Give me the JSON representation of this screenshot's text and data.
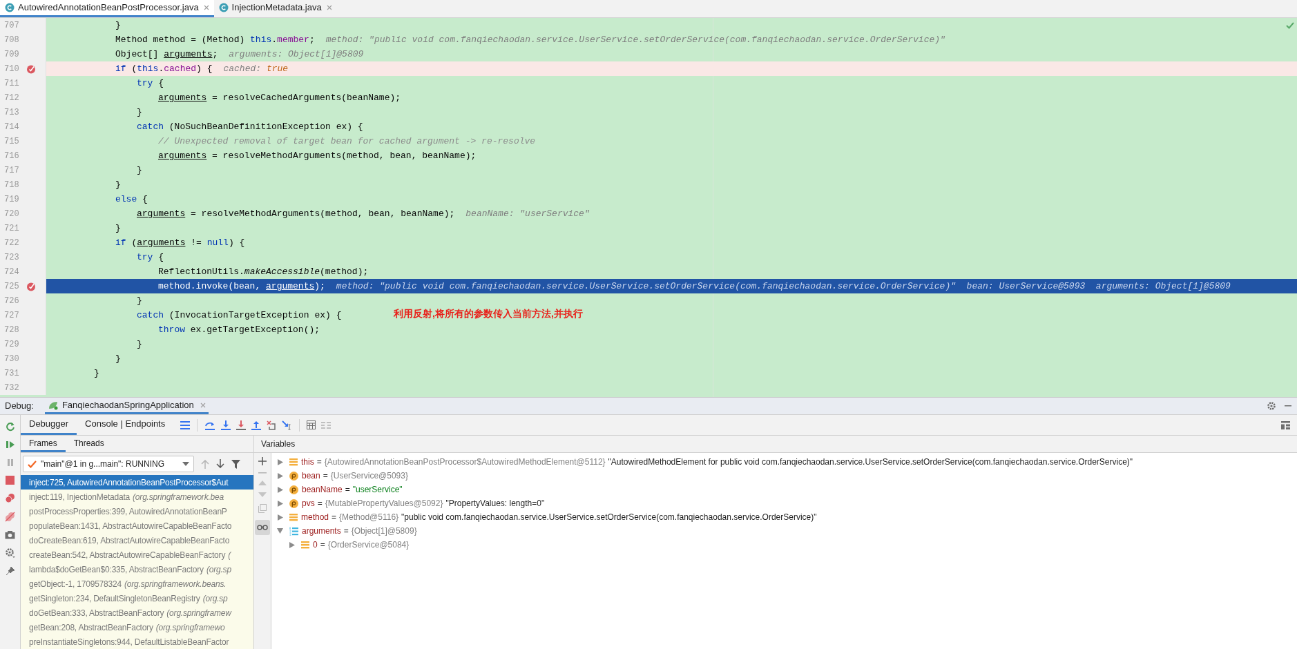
{
  "editor_tabs": [
    {
      "label": "AutowiredAnnotationBeanPostProcessor.java",
      "selected": true
    },
    {
      "label": "InjectionMetadata.java",
      "selected": false
    }
  ],
  "code_lines": [
    {
      "number": "707",
      "kind": "indent2",
      "breakpoint": false,
      "current": false,
      "segments": [
        {
          "kind": "plain",
          "text": "}"
        }
      ]
    },
    {
      "number": "708",
      "kind": "indent2",
      "breakpoint": false,
      "current": false,
      "segments": [
        {
          "kind": "plain",
          "text": "Method method = (Method) "
        },
        {
          "kind": "keyword",
          "text": "this"
        },
        {
          "kind": "plain",
          "text": "."
        },
        {
          "kind": "field",
          "text": "member"
        },
        {
          "kind": "plain",
          "text": ";"
        }
      ],
      "hints": [
        {
          "kind": "hint",
          "text": "method: \"public void com.fanqiechaodan.service.UserService.setOrderService(com.fanqiechaodan.service.OrderService)\""
        }
      ]
    },
    {
      "number": "709",
      "kind": "indent2",
      "breakpoint": false,
      "current": false,
      "segments": [
        {
          "kind": "plain",
          "text": "Object[] "
        },
        {
          "kind": "var",
          "text": "arguments"
        },
        {
          "kind": "plain",
          "text": ";"
        }
      ],
      "hints": [
        {
          "kind": "hint",
          "text": "arguments: Object[1]@5809"
        }
      ]
    },
    {
      "number": "710",
      "kind": "indent2",
      "breakpoint": true,
      "current": false,
      "segments": [
        {
          "kind": "keyword",
          "text": "if"
        },
        {
          "kind": "plain",
          "text": " ("
        },
        {
          "kind": "keyword",
          "text": "this"
        },
        {
          "kind": "plain",
          "text": "."
        },
        {
          "kind": "field",
          "text": "cached"
        },
        {
          "kind": "plain",
          "text": ") {"
        }
      ],
      "hints": [
        {
          "kind": "hint",
          "text": "cached: "
        },
        {
          "kind": "hint_value",
          "text": "true"
        }
      ]
    },
    {
      "number": "711",
      "kind": "indent3",
      "breakpoint": false,
      "current": false,
      "segments": [
        {
          "kind": "keyword",
          "text": "try"
        },
        {
          "kind": "plain",
          "text": " {"
        }
      ]
    },
    {
      "number": "712",
      "kind": "indent4",
      "breakpoint": false,
      "current": false,
      "segments": [
        {
          "kind": "var",
          "text": "arguments"
        },
        {
          "kind": "plain",
          "text": " = resolveCachedArguments(beanName);"
        }
      ]
    },
    {
      "number": "713",
      "kind": "indent3",
      "breakpoint": false,
      "current": false,
      "segments": [
        {
          "kind": "plain",
          "text": "}"
        }
      ]
    },
    {
      "number": "714",
      "kind": "indent3",
      "breakpoint": false,
      "current": false,
      "segments": [
        {
          "kind": "keyword",
          "text": "catch"
        },
        {
          "kind": "plain",
          "text": " (NoSuchBeanDefinitionException ex) {"
        }
      ]
    },
    {
      "number": "715",
      "kind": "indent4",
      "breakpoint": false,
      "current": false,
      "segments": [
        {
          "kind": "comment",
          "text": "// Unexpected removal of target bean for cached argument -> re-resolve"
        }
      ]
    },
    {
      "number": "716",
      "kind": "indent4",
      "breakpoint": false,
      "current": false,
      "segments": [
        {
          "kind": "var",
          "text": "arguments"
        },
        {
          "kind": "plain",
          "text": " = resolveMethodArguments(method, bean, beanName);"
        }
      ]
    },
    {
      "number": "717",
      "kind": "indent3",
      "breakpoint": false,
      "current": false,
      "segments": [
        {
          "kind": "plain",
          "text": "}"
        }
      ]
    },
    {
      "number": "718",
      "kind": "indent2",
      "breakpoint": false,
      "current": false,
      "segments": [
        {
          "kind": "plain",
          "text": "}"
        }
      ]
    },
    {
      "number": "719",
      "kind": "indent2",
      "breakpoint": false,
      "current": false,
      "segments": [
        {
          "kind": "keyword",
          "text": "else"
        },
        {
          "kind": "plain",
          "text": " {"
        }
      ]
    },
    {
      "number": "720",
      "kind": "indent3",
      "breakpoint": false,
      "current": false,
      "segments": [
        {
          "kind": "var",
          "text": "arguments"
        },
        {
          "kind": "plain",
          "text": " = resolveMethodArguments(method, bean, beanName);"
        }
      ],
      "hints": [
        {
          "kind": "hint",
          "text": "beanName: \"userService\""
        }
      ]
    },
    {
      "number": "721",
      "kind": "indent2",
      "breakpoint": false,
      "current": false,
      "segments": [
        {
          "kind": "plain",
          "text": "}"
        }
      ]
    },
    {
      "number": "722",
      "kind": "indent2",
      "breakpoint": false,
      "current": false,
      "segments": [
        {
          "kind": "keyword",
          "text": "if"
        },
        {
          "kind": "plain",
          "text": " ("
        },
        {
          "kind": "var",
          "text": "arguments"
        },
        {
          "kind": "plain",
          "text": " != "
        },
        {
          "kind": "keyword",
          "text": "null"
        },
        {
          "kind": "plain",
          "text": ") {"
        }
      ]
    },
    {
      "number": "723",
      "kind": "indent3",
      "breakpoint": false,
      "current": false,
      "segments": [
        {
          "kind": "keyword",
          "text": "try"
        },
        {
          "kind": "plain",
          "text": " {"
        }
      ]
    },
    {
      "number": "724",
      "kind": "indent4",
      "breakpoint": false,
      "current": false,
      "segments": [
        {
          "kind": "plain",
          "text": "ReflectionUtils."
        },
        {
          "kind": "static_method",
          "text": "makeAccessible"
        },
        {
          "kind": "plain",
          "text": "(method);"
        }
      ]
    },
    {
      "number": "725",
      "kind": "indent4",
      "breakpoint": true,
      "current": true,
      "segments": [
        {
          "kind": "plain",
          "text": "method.invoke(bean, "
        },
        {
          "kind": "var",
          "text": "arguments"
        },
        {
          "kind": "plain",
          "text": ");"
        }
      ],
      "hints": [
        {
          "kind": "hint",
          "text": "method: \"public void com.fanqiechaodan.service.UserService.setOrderService(com.fanqiechaodan.service.OrderService)\"  bean: UserService@5093  arguments: Object[1]@5809"
        }
      ]
    },
    {
      "number": "726",
      "kind": "indent3",
      "breakpoint": false,
      "current": false,
      "segments": [
        {
          "kind": "plain",
          "text": "}"
        }
      ]
    },
    {
      "number": "727",
      "kind": "indent3",
      "breakpoint": false,
      "current": false,
      "segments": [
        {
          "kind": "keyword",
          "text": "catch"
        },
        {
          "kind": "plain",
          "text": " (InvocationTargetException ex) {"
        }
      ]
    },
    {
      "number": "728",
      "kind": "indent4",
      "breakpoint": false,
      "current": false,
      "segments": [
        {
          "kind": "keyword",
          "text": "throw"
        },
        {
          "kind": "plain",
          "text": " ex.getTargetException();"
        }
      ]
    },
    {
      "number": "729",
      "kind": "indent3",
      "breakpoint": false,
      "current": false,
      "segments": [
        {
          "kind": "plain",
          "text": "}"
        }
      ]
    },
    {
      "number": "730",
      "kind": "indent2",
      "breakpoint": false,
      "current": false,
      "segments": [
        {
          "kind": "plain",
          "text": "}"
        }
      ]
    },
    {
      "number": "731",
      "kind": "indent1",
      "breakpoint": false,
      "current": false,
      "segments": [
        {
          "kind": "plain",
          "text": "}"
        }
      ]
    },
    {
      "number": "732",
      "kind": "indent1",
      "breakpoint": false,
      "current": false
    }
  ],
  "annotation": "利用反射,将所有的参数传入当前方法,并执行",
  "debug": {
    "label": "Debug:",
    "session_tab": "FanqiechaodanSpringApplication",
    "tabs": [
      {
        "label": "Debugger",
        "selected": true
      },
      {
        "label": "Console | Endpoints",
        "selected": false
      }
    ],
    "frame_tabs": [
      {
        "label": "Frames",
        "selected": true
      },
      {
        "label": "Threads",
        "selected": false
      }
    ],
    "thread": "\"main\"@1 in g...main\": RUNNING",
    "frames": [
      {
        "text": "inject:725, AutowiredAnnotationBeanPostProcessor$Aut",
        "selected": true
      },
      {
        "text": "inject:119, InjectionMetadata",
        "package": "(org.springframework.bea",
        "selected": false
      },
      {
        "text": "postProcessProperties:399, AutowiredAnnotationBeanP",
        "selected": false
      },
      {
        "text": "populateBean:1431, AbstractAutowireCapableBeanFacto",
        "selected": false
      },
      {
        "text": "doCreateBean:619, AbstractAutowireCapableBeanFacto",
        "selected": false
      },
      {
        "text": "createBean:542, AbstractAutowireCapableBeanFactory",
        "package": "(",
        "selected": false
      },
      {
        "text": "lambda$doGetBean$0:335, AbstractBeanFactory",
        "package": "(org.sp",
        "selected": false
      },
      {
        "text": "getObject:-1, 1709578324",
        "package": "(org.springframework.beans.",
        "selected": false
      },
      {
        "text": "getSingleton:234, DefaultSingletonBeanRegistry",
        "package": "(org.sp",
        "selected": false
      },
      {
        "text": "doGetBean:333, AbstractBeanFactory",
        "package": "(org.springframew",
        "selected": false
      },
      {
        "text": "getBean:208, AbstractBeanFactory",
        "package": "(org.springframewo",
        "selected": false
      },
      {
        "text": "preInstantiateSingletons:944, DefaultListableBeanFactor",
        "selected": false
      }
    ],
    "variables_title": "Variables",
    "variables": [
      {
        "kind": "field",
        "name": "this",
        "assign": "=",
        "ref": "{AutowiredAnnotationBeanPostProcessor$AutowiredMethodElement@5112}",
        "value": "\"AutowiredMethodElement for public void com.fanqiechaodan.service.UserService.setOrderService(com.fanqiechaodan.service.OrderService)\"",
        "string_literal": false,
        "expanded": false
      },
      {
        "kind": "param",
        "name": "bean",
        "assign": "=",
        "ref": "{UserService@5093}",
        "expanded": false
      },
      {
        "kind": "param",
        "name": "beanName",
        "assign": "=",
        "value": "\"userService\"",
        "string_literal": true,
        "expanded": false
      },
      {
        "kind": "param",
        "name": "pvs",
        "assign": "=",
        "ref": "{MutablePropertyValues@5092}",
        "value": "\"PropertyValues: length=0\"",
        "string_literal": false,
        "expanded": false
      },
      {
        "kind": "field",
        "name": "method",
        "assign": "=",
        "ref": "{Method@5116}",
        "value": "\"public void com.fanqiechaodan.service.UserService.setOrderService(com.fanqiechaodan.service.OrderService)\"",
        "string_literal": false,
        "expanded": false
      },
      {
        "kind": "array",
        "name": "arguments",
        "assign": "=",
        "ref": "{Object[1]@5809}",
        "expanded": true,
        "children": [
          {
            "kind": "field",
            "name": "0",
            "assign": "=",
            "ref": "{OrderService@5084}",
            "expanded": false
          }
        ]
      }
    ]
  }
}
